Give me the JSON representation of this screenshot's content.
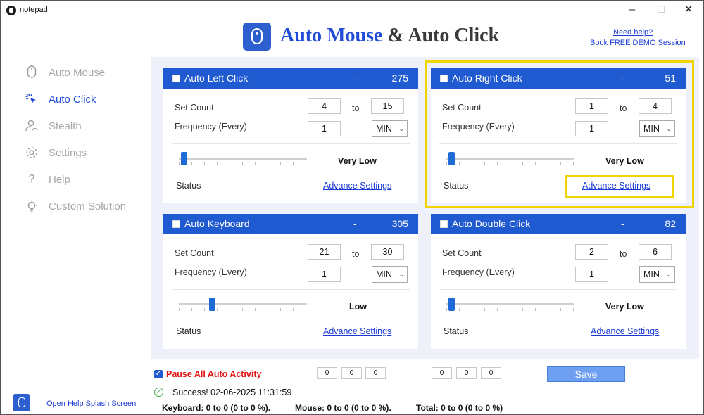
{
  "window": {
    "title": "notepad"
  },
  "header": {
    "title_part1": "Auto Mouse",
    "title_part2": "& Auto Click",
    "help_link": "Need help?",
    "demo_link": "Book FREE DEMO Session"
  },
  "sidebar": {
    "items": [
      {
        "label": "Auto Mouse",
        "icon": "mouse-icon",
        "active": false
      },
      {
        "label": "Auto Click",
        "icon": "click-icon",
        "active": true
      },
      {
        "label": "Stealth",
        "icon": "stealth-icon",
        "active": false
      },
      {
        "label": "Settings",
        "icon": "gear-icon",
        "active": false
      },
      {
        "label": "Help",
        "icon": "question-icon",
        "active": false
      },
      {
        "label": "Custom Solution",
        "icon": "bulb-icon",
        "active": false
      }
    ]
  },
  "cards": {
    "left_click": {
      "title": "Auto Left Click",
      "dash": "-",
      "value": "275",
      "count_from": "4",
      "count_to": "15",
      "frequency": "1",
      "unit": "MIN",
      "speed": "Very Low",
      "slider_level": 0.02
    },
    "right_click": {
      "title": "Auto Right Click",
      "dash": "-",
      "value": "51",
      "count_from": "1",
      "count_to": "4",
      "frequency": "1",
      "unit": "MIN",
      "speed": "Very Low",
      "slider_level": 0.02
    },
    "keyboard": {
      "title": "Auto Keyboard",
      "dash": "-",
      "value": "305",
      "count_from": "21",
      "count_to": "30",
      "frequency": "1",
      "unit": "MIN",
      "speed": "Low",
      "slider_level": 0.25
    },
    "double_click": {
      "title": "Auto Double Click",
      "dash": "-",
      "value": "82",
      "count_from": "2",
      "count_to": "6",
      "frequency": "1",
      "unit": "MIN",
      "speed": "Very Low",
      "slider_level": 0.02
    }
  },
  "labels": {
    "set_count": "Set Count",
    "to": "to",
    "frequency": "Frequency (Every)",
    "status": "Status",
    "advance": "Advance Settings"
  },
  "footer": {
    "pause_label": "Pause All Auto Activity",
    "time_a": [
      "0",
      "0",
      "0"
    ],
    "time_b": [
      "0",
      "0",
      "0"
    ],
    "save_label": "Save",
    "success": "Success! 02-06-2025 11:31:59",
    "keyboard_stat": "Keyboard: 0 to 0 (0 to 0 %).",
    "mouse_stat": "Mouse: 0 to 0 (0 to 0 %).",
    "total_stat": "Total: 0 to 0 (0 to 0 %)",
    "splash_link": "Open Help Splash Screen"
  },
  "colors": {
    "accent": "#1f5ad0",
    "highlight": "#f0d400",
    "warning": "#e01616"
  }
}
